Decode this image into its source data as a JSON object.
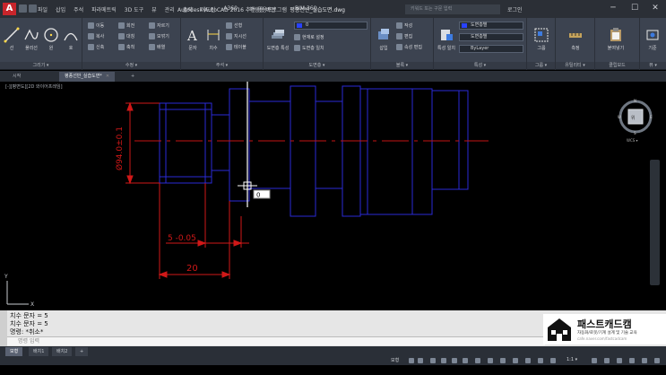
{
  "titlebar": {
    "logo": "A",
    "menu": [
      "파일",
      "삽입",
      "주석",
      "파라메트릭",
      "3D 도구",
      "뷰",
      "관리",
      "출력",
      "애드인",
      "A360",
      "추천 응용프로그램",
      "BIM 360",
      "Performance"
    ],
    "app_title": "Autodesk AutoCAD 2016 - 학생용 버전",
    "doc_title": "평종선반_실습도면.dwg",
    "search_placeholder": "키워드 또는 구문 입력",
    "user": "로그인",
    "minimize": "─",
    "maximize": "☐",
    "close": "✕"
  },
  "ribbon": {
    "panels": [
      {
        "title": "그리기 ▾"
      },
      {
        "title": "수정 ▾"
      },
      {
        "title": "주석 ▾"
      },
      {
        "title": "도면층 ▾"
      },
      {
        "title": "블록 ▾"
      },
      {
        "title": "특성 ▾"
      },
      {
        "title": "그룹 ▾"
      },
      {
        "title": "유틸리티 ▾"
      },
      {
        "title": "클립보드"
      },
      {
        "title": "뷰 ▾"
      }
    ],
    "draw": {
      "line": "선",
      "polyline": "폴리선",
      "circle": "원",
      "arc": "호"
    },
    "modify": {
      "move": "이동",
      "rotate": "회전",
      "trim": "자르기",
      "copy": "복사",
      "mirror": "대칭",
      "fillet": "모깎기",
      "stretch": "신축",
      "scale": "축척",
      "array": "배열"
    },
    "annotation": {
      "text": "문자",
      "dimension": "치수",
      "linear": "선형",
      "leader": "지시선",
      "table": "테이블"
    },
    "layer": {
      "props": "도면층 특성",
      "current": "0",
      "make_current": "현재로 설정",
      "match": "도면층 일치"
    },
    "block": {
      "insert": "삽입",
      "create": "작성",
      "edit": "편집",
      "edit_attr": "속성 편집"
    },
    "properties": {
      "match": "특성 일치",
      "color": "도면층별",
      "linetype": "도면층별",
      "lineweight": "ByLayer"
    },
    "group": {
      "group": "그룹"
    },
    "utility": {
      "measure": "측정"
    },
    "clipboard": {
      "paste": "붙여넣기"
    },
    "view": {
      "base": "기준"
    }
  },
  "filetabs": [
    {
      "label": "시작",
      "active": false
    },
    {
      "label": "평종선반_실습도면*",
      "active": true
    },
    {
      "label": "+",
      "active": false
    }
  ],
  "viewport_label": "[-][평면도][2D 와이어프레임]",
  "canvas": {
    "dim_vertical": "Ø94.0±0.1",
    "dim_small": "5 -0.05",
    "dim_bottom": "20",
    "dynamic_input": "0",
    "navcube_face": "위",
    "compass": [
      "N",
      "E",
      "S",
      "W"
    ],
    "wcs": "WCS ▾",
    "ucs_y": "Y",
    "ucs_x": "X"
  },
  "cmdline": {
    "history": [
      "치수 문자 = 5",
      "치수 문자 = 5",
      "명령: *취소*"
    ],
    "placeholder": "명령 입력"
  },
  "watermark": {
    "brand": "패스트캐드캠",
    "slogan": "자동화/로봇/기계 설계 및 기술 교육",
    "url": "cafe.naver.com/fastcadcam"
  },
  "layouttabs": [
    {
      "label": "모형",
      "active": true
    },
    {
      "label": "배치1",
      "active": false
    },
    {
      "label": "배치2",
      "active": false
    },
    {
      "label": "+",
      "active": false
    }
  ],
  "statusbar": {
    "model": "모형",
    "scale": "1:1 ▾"
  },
  "colors": {
    "drafting_blue": "#2a2ad6",
    "dimension_red": "#d01818",
    "centerline_red": "#c41414",
    "crosshair": "#ffffff",
    "accent_red": "#c8252b"
  }
}
